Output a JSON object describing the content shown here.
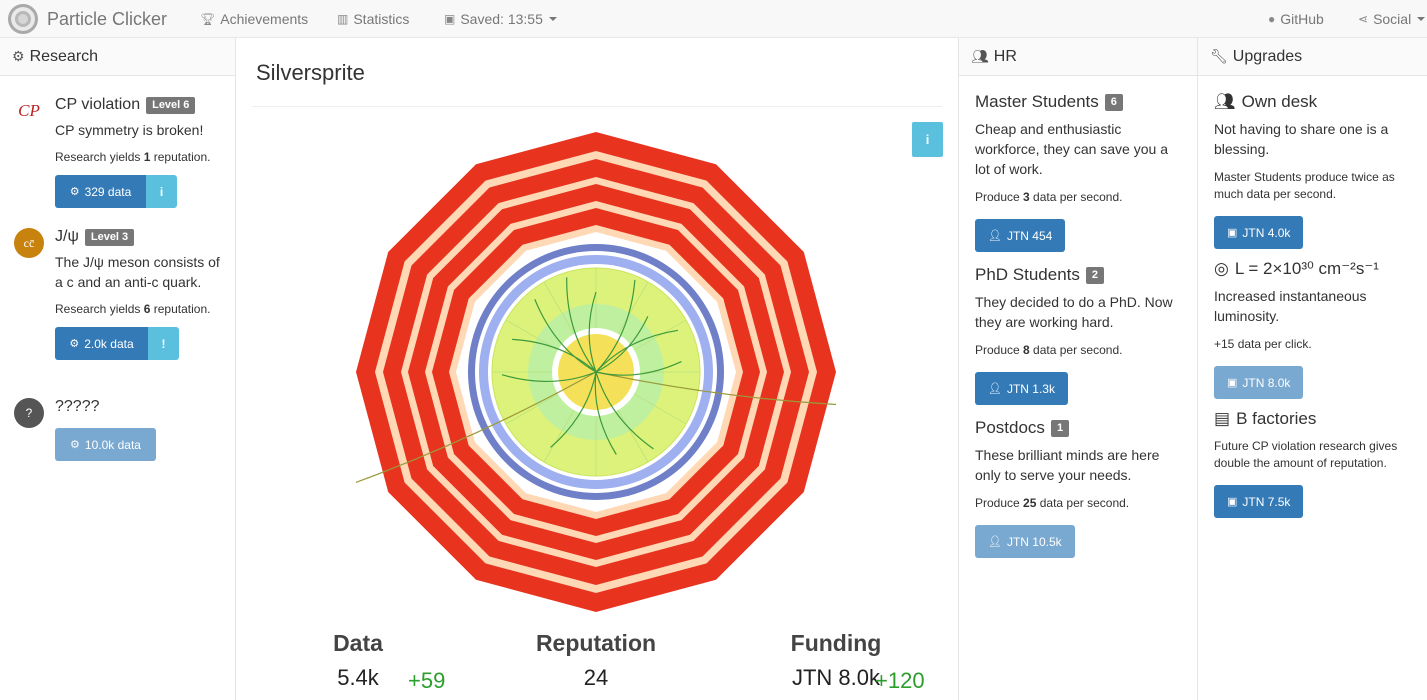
{
  "navbar": {
    "brand": "Particle Clicker",
    "achievements": "Achievements",
    "statistics": "Statistics",
    "saved": "Saved: 13:55",
    "github": "GitHub",
    "social": "Social"
  },
  "research": {
    "heading": "Research",
    "items": [
      {
        "icon": "CP",
        "name": "CP violation",
        "level": "Level 6",
        "description": "CP symmetry is broken!",
        "yield_pre": "Research yields ",
        "yield_num": "1",
        "yield_post": " reputation.",
        "cost": "329 data",
        "info": "i"
      },
      {
        "icon": "cc̄",
        "name": "J/ψ",
        "level": "Level 3",
        "description": "The J/ψ meson consists of a c and an anti-c quark.",
        "yield_pre": "Research yields ",
        "yield_num": "6",
        "yield_post": " reputation.",
        "cost": "2.0k data",
        "info": "!"
      },
      {
        "icon": "?",
        "name": "?????",
        "cost": "10.0k data"
      }
    ]
  },
  "center": {
    "title": "Silverspritе",
    "info": "i",
    "stats": {
      "data_label": "Data",
      "data_value": "5.4k",
      "data_delta": "+59",
      "reputation_label": "Reputation",
      "reputation_value": "24",
      "funding_label": "Funding",
      "funding_value": "JTN 8.0k",
      "funding_delta": "+120"
    }
  },
  "hr": {
    "heading": "HR",
    "items": [
      {
        "name": "Master Students",
        "count": "6",
        "description": "Cheap and enthusiastic workforce, they can save you a lot of work.",
        "prod_pre": "Produce ",
        "prod_num": "3",
        "prod_post": " data per second.",
        "cost": "JTN 454"
      },
      {
        "name": "PhD Students",
        "count": "2",
        "description": "They decided to do a PhD. Now they are working hard.",
        "prod_pre": "Produce ",
        "prod_num": "8",
        "prod_post": " data per second.",
        "cost": "JTN 1.3k"
      },
      {
        "name": "Postdocs",
        "count": "1",
        "description": "These brilliant minds are here only to serve your needs.",
        "prod_pre": "Produce ",
        "prod_num": "25",
        "prod_post": " data per second.",
        "cost": "JTN 10.5k"
      }
    ]
  },
  "upgrades": {
    "heading": "Upgrades",
    "items": [
      {
        "name": "Own desk",
        "description": "Not having to share one is a blessing.",
        "effect": "Master Students produce twice as much data per second.",
        "cost": "JTN 4.0k"
      },
      {
        "name": "L = 2×10³⁰ cm⁻²s⁻¹",
        "description": "Increased instantaneous luminosity.",
        "effect": "+15 data per click.",
        "cost": "JTN 8.0k"
      },
      {
        "name": "B factories",
        "effect": "Future CP violation research gives double the amount of reputation.",
        "cost": "JTN 7.5k"
      }
    ]
  },
  "colors": {
    "primary": "#337ab7",
    "info": "#5bc0de",
    "detector_red": "#e8331f",
    "delta_green": "#2c9e2c"
  },
  "icons": [
    "trophy-icon",
    "bar-chart-icon",
    "floppy-icon",
    "github-icon",
    "share-icon",
    "cogs-icon",
    "users-icon",
    "wrench-icon",
    "user-icon",
    "money-icon",
    "target-icon",
    "newspaper-icon"
  ]
}
